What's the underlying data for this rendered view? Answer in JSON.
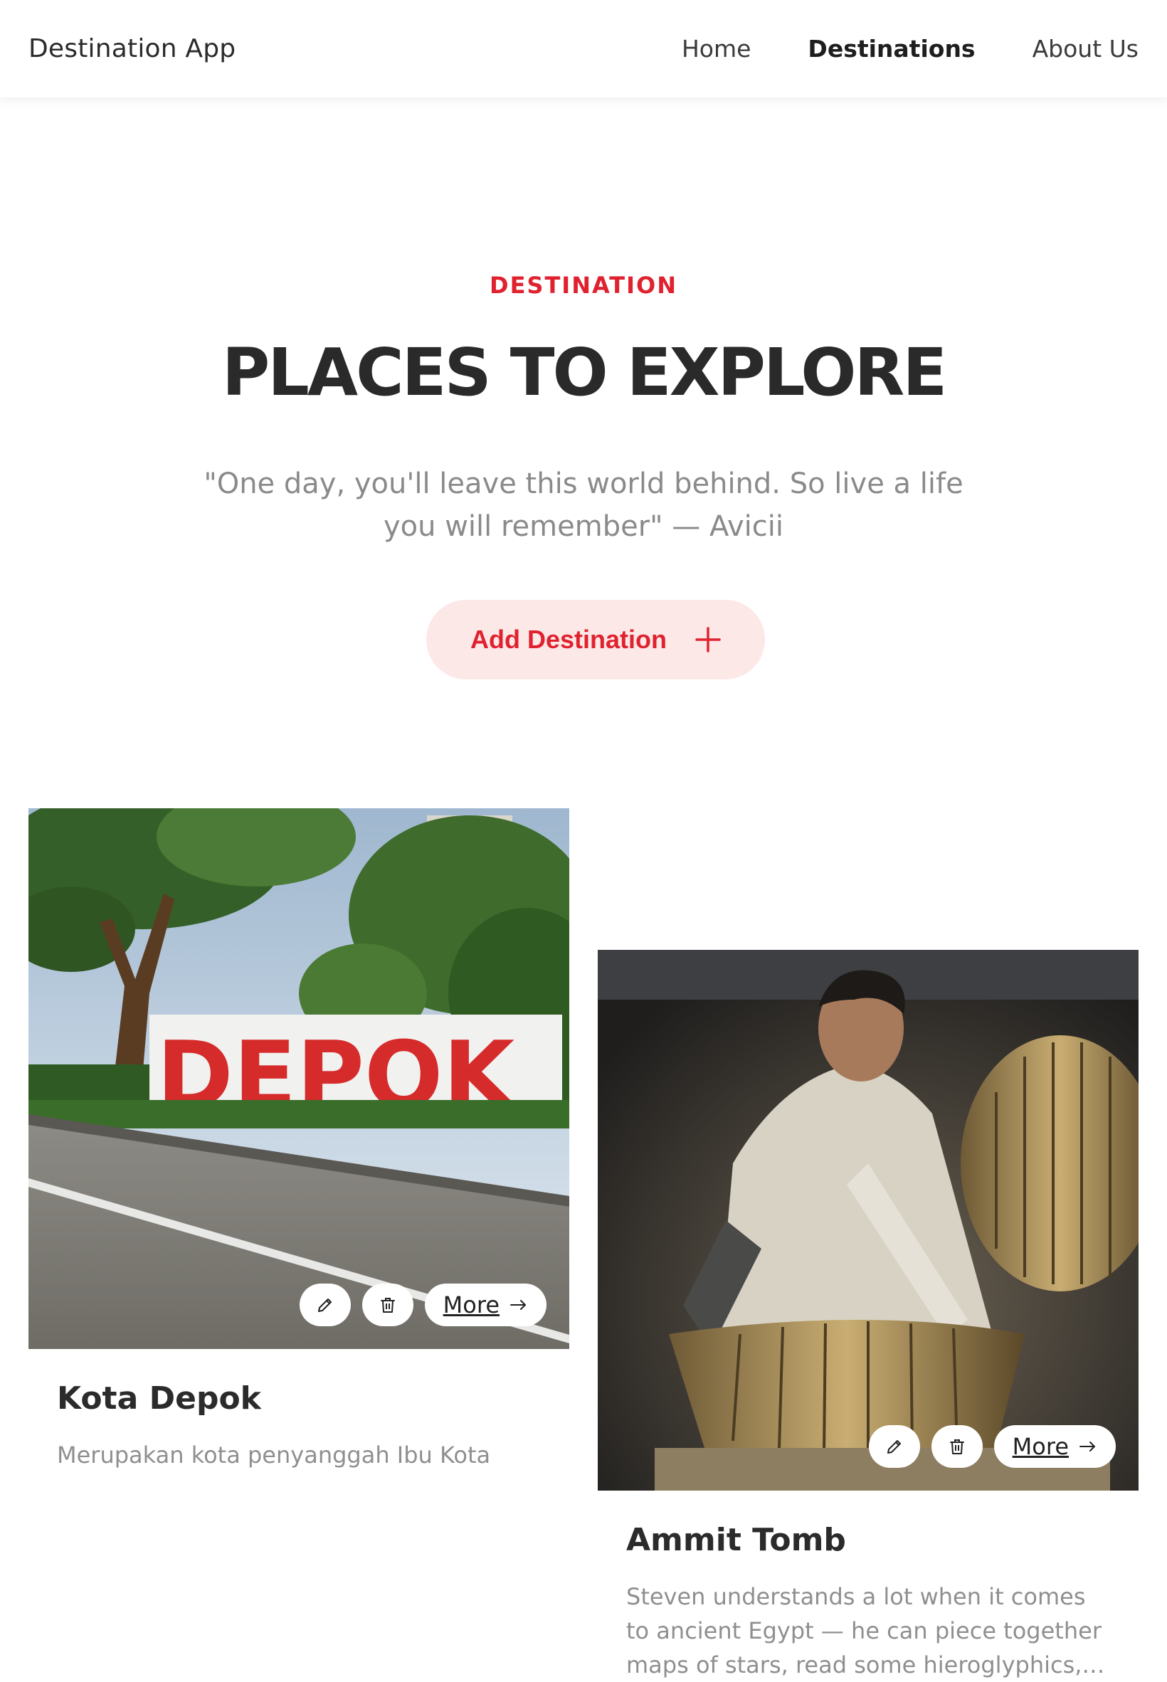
{
  "navbar": {
    "brand": "Destination App",
    "links": [
      {
        "label": "Home"
      },
      {
        "label": "Destinations"
      },
      {
        "label": "About Us"
      }
    ]
  },
  "hero": {
    "eyebrow": "DESTINATION",
    "title": "PLACES TO EXPLORE",
    "quote": "\"One day, you'll leave this world behind. So live a life you will remember\" — Avicii",
    "add_button": "Add Destination"
  },
  "cards": [
    {
      "title": "Kota Depok",
      "description": "Merupakan kota penyanggah Ibu Kota",
      "more_label": "More",
      "image_sign_text": "DEPOK"
    },
    {
      "title": "Ammit Tomb",
      "description": "Steven understands a lot when it comes to ancient Egypt — he can piece together maps of stars, read some hieroglyphics, and more.",
      "more_label": "More"
    }
  ],
  "colors": {
    "accent": "#e0222f",
    "accent_light": "#fde8e8",
    "text_dark": "#2b2b2b",
    "text_muted": "#8a8a8a"
  },
  "icons": {
    "add": "plus-icon",
    "edit": "pencil-icon",
    "delete": "trash-icon",
    "more": "arrow-right-icon"
  }
}
